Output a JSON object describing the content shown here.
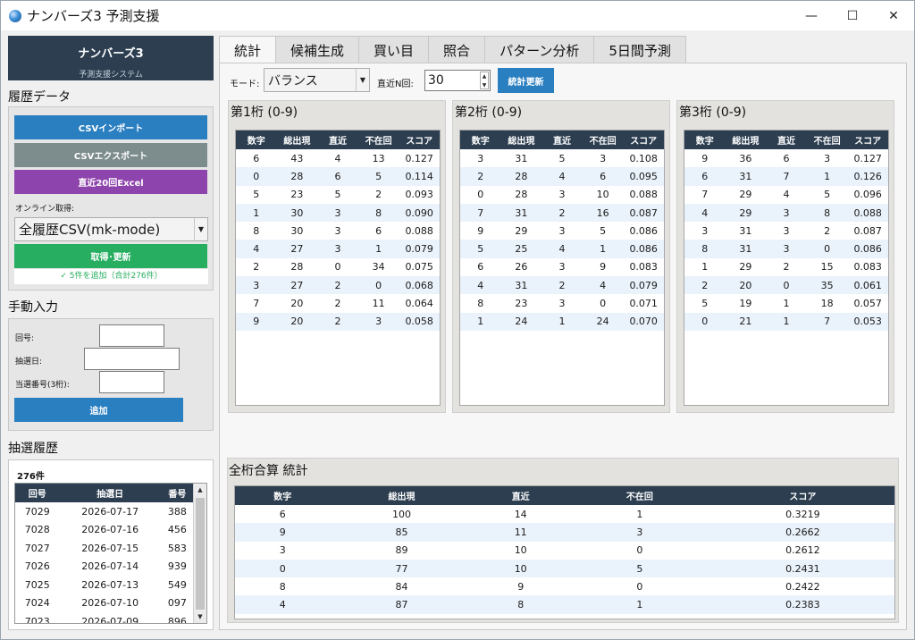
{
  "window": {
    "title": "ナンバーズ3 予測支援",
    "controls": {
      "minimize": "—",
      "maximize": "☐",
      "close": "✕"
    }
  },
  "brand": {
    "title": "ナンバーズ3",
    "subtitle": "予測支援システム"
  },
  "history_data": {
    "section_title": "履歴データ",
    "csv_import_label": "CSVインポート",
    "csv_export_label": "CSVエクスポート",
    "recent_excel_label": "直近20回Excel",
    "online_label": "オンライン取得:",
    "online_source": "全履歴CSV(mk-mode)",
    "fetch_label": "取得･更新",
    "status_note": "✓ 5件を追加（合計276件）"
  },
  "manual_input": {
    "section_title": "手動入力",
    "round_label": "回号:",
    "date_label": "抽選日:",
    "number_label": "当選番号(3桁):",
    "round_value": "",
    "date_value": "",
    "number_value": "",
    "add_label": "追加"
  },
  "draw_history": {
    "section_title": "抽選履歴",
    "count_label": "276件",
    "columns": [
      "回号",
      "抽選日",
      "番号"
    ],
    "rows": [
      [
        "7029",
        "2026-07-17",
        "388"
      ],
      [
        "7028",
        "2026-07-16",
        "456"
      ],
      [
        "7027",
        "2026-07-15",
        "583"
      ],
      [
        "7026",
        "2026-07-14",
        "939"
      ],
      [
        "7025",
        "2026-07-13",
        "549"
      ],
      [
        "7024",
        "2026-07-10",
        "097"
      ],
      [
        "7023",
        "2026-07-09",
        "896"
      ]
    ]
  },
  "tabs": [
    {
      "label": "統計",
      "active": true
    },
    {
      "label": "候補生成",
      "active": false
    },
    {
      "label": "買い目",
      "active": false
    },
    {
      "label": "照合",
      "active": false
    },
    {
      "label": "パターン分析",
      "active": false
    },
    {
      "label": "5日間予測",
      "active": false
    }
  ],
  "toolbar": {
    "mode_label": "モード:",
    "mode_value": "バランス",
    "recent_n_label": "直近N回:",
    "recent_n_value": "30",
    "refresh_label": "統計更新"
  },
  "stat_columns": [
    "数字",
    "総出現",
    "直近",
    "不在回",
    "スコア"
  ],
  "digit_tables": [
    {
      "title": "第1桁 (0-9)",
      "rows": [
        [
          "6",
          "43",
          "4",
          "13",
          "0.127"
        ],
        [
          "0",
          "28",
          "6",
          "5",
          "0.114"
        ],
        [
          "5",
          "23",
          "5",
          "2",
          "0.093"
        ],
        [
          "1",
          "30",
          "3",
          "8",
          "0.090"
        ],
        [
          "8",
          "30",
          "3",
          "6",
          "0.088"
        ],
        [
          "4",
          "27",
          "3",
          "1",
          "0.079"
        ],
        [
          "2",
          "28",
          "0",
          "34",
          "0.075"
        ],
        [
          "3",
          "27",
          "2",
          "0",
          "0.068"
        ],
        [
          "7",
          "20",
          "2",
          "11",
          "0.064"
        ],
        [
          "9",
          "20",
          "2",
          "3",
          "0.058"
        ]
      ]
    },
    {
      "title": "第2桁 (0-9)",
      "rows": [
        [
          "3",
          "31",
          "5",
          "3",
          "0.108"
        ],
        [
          "2",
          "28",
          "4",
          "6",
          "0.095"
        ],
        [
          "0",
          "28",
          "3",
          "10",
          "0.088"
        ],
        [
          "7",
          "31",
          "2",
          "16",
          "0.087"
        ],
        [
          "9",
          "29",
          "3",
          "5",
          "0.086"
        ],
        [
          "5",
          "25",
          "4",
          "1",
          "0.086"
        ],
        [
          "6",
          "26",
          "3",
          "9",
          "0.083"
        ],
        [
          "4",
          "31",
          "2",
          "4",
          "0.079"
        ],
        [
          "8",
          "23",
          "3",
          "0",
          "0.071"
        ],
        [
          "1",
          "24",
          "1",
          "24",
          "0.070"
        ]
      ]
    },
    {
      "title": "第3桁 (0-9)",
      "rows": [
        [
          "9",
          "36",
          "6",
          "3",
          "0.127"
        ],
        [
          "6",
          "31",
          "7",
          "1",
          "0.126"
        ],
        [
          "7",
          "29",
          "4",
          "5",
          "0.096"
        ],
        [
          "4",
          "29",
          "3",
          "8",
          "0.088"
        ],
        [
          "3",
          "31",
          "3",
          "2",
          "0.087"
        ],
        [
          "8",
          "31",
          "3",
          "0",
          "0.086"
        ],
        [
          "1",
          "29",
          "2",
          "15",
          "0.083"
        ],
        [
          "2",
          "20",
          "0",
          "35",
          "0.061"
        ],
        [
          "5",
          "19",
          "1",
          "18",
          "0.057"
        ],
        [
          "0",
          "21",
          "1",
          "7",
          "0.053"
        ]
      ]
    }
  ],
  "total_stats": {
    "title": "全桁合算 統計",
    "rows": [
      [
        "6",
        "100",
        "14",
        "1",
        "0.3219"
      ],
      [
        "9",
        "85",
        "11",
        "3",
        "0.2662"
      ],
      [
        "3",
        "89",
        "10",
        "0",
        "0.2612"
      ],
      [
        "0",
        "77",
        "10",
        "5",
        "0.2431"
      ],
      [
        "8",
        "84",
        "9",
        "0",
        "0.2422"
      ],
      [
        "4",
        "87",
        "8",
        "1",
        "0.2383"
      ]
    ]
  },
  "colors": {
    "header_navy": "#2c3e50",
    "button_blue": "#2a7fc1",
    "button_gray": "#7d8c8d",
    "button_purple": "#8e44ad",
    "button_green": "#27ae60",
    "row_alt": "#eaf2fb"
  }
}
